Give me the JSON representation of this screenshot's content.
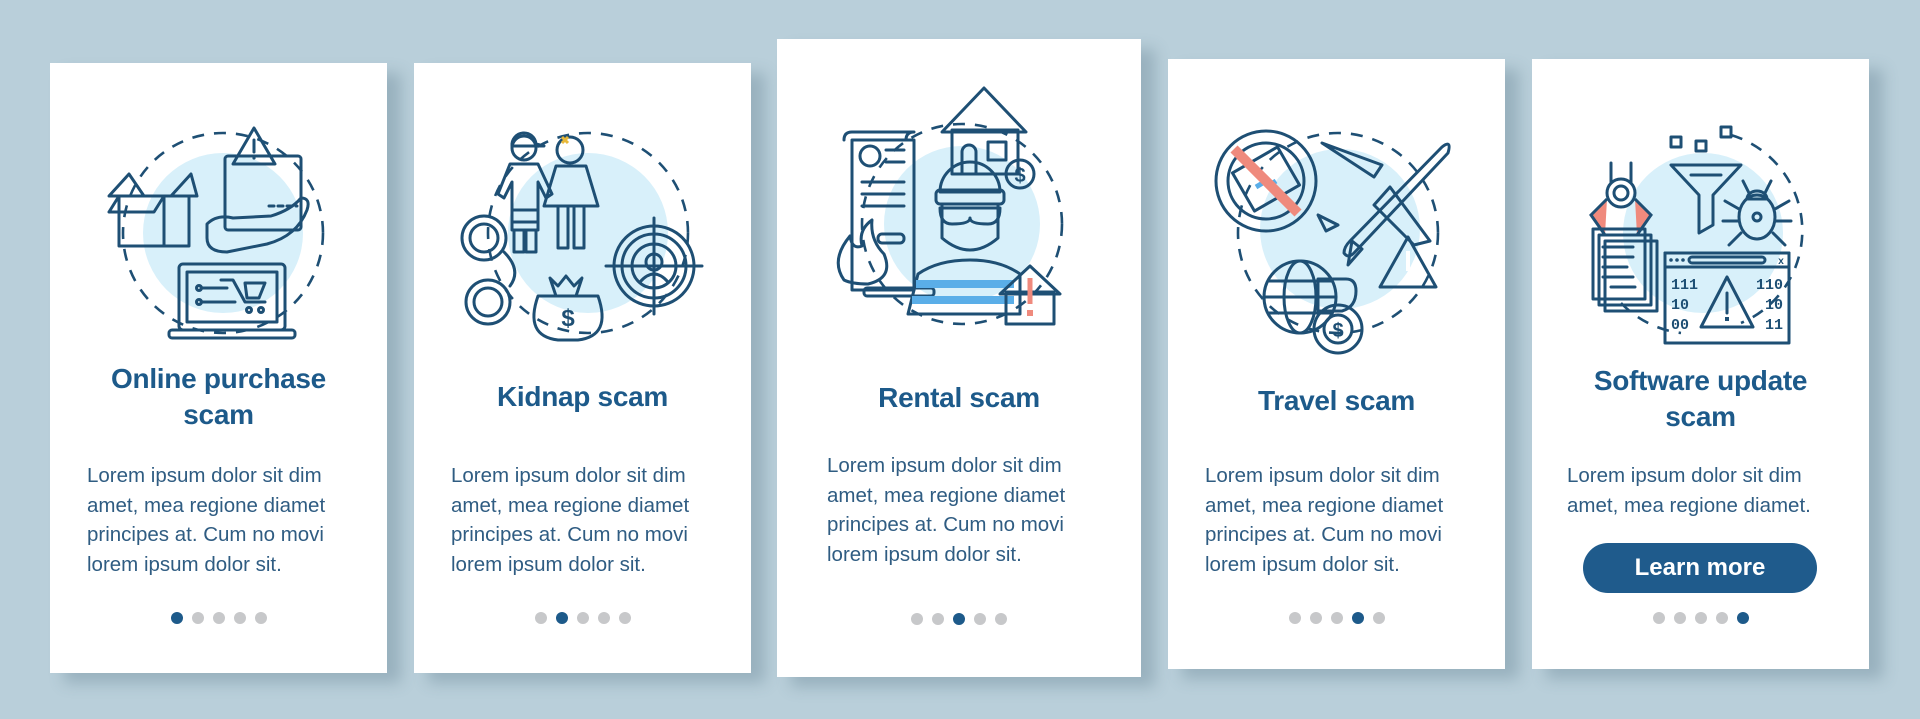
{
  "colors": {
    "background": "#b9cfda",
    "card": "#ffffff",
    "primary": "#1d5a8a",
    "body_text": "#2f5c82",
    "dot_inactive": "#c7c8ca",
    "illustration_blue": "#5aaee8",
    "illustration_yellow": "#f6d17f",
    "illustration_red": "#ef8a7d",
    "illustration_bg": "#d8f0fa"
  },
  "screens": [
    {
      "title_line1": "Online purchase",
      "title_line2": "scam",
      "illustration": "online-purchase-illustration",
      "body": "Lorem ipsum dolor sit dim\namet, mea regione diamet\nprincipes at. Cum no movi\nlorem ipsum dolor sit.",
      "page_index": 1,
      "page_count": 5
    },
    {
      "title_line1": "Kidnap scam",
      "illustration": "kidnap-illustration",
      "body": "Lorem ipsum dolor sit dim\namet, mea regione diamet\nprincipes at. Cum no movi\nlorem ipsum dolor sit.",
      "page_index": 2,
      "page_count": 5
    },
    {
      "title_line1": "Rental scam",
      "illustration": "rental-illustration",
      "body": "Lorem ipsum dolor sit dim\namet, mea regione diamet\nprincipes at. Cum no movi\nlorem ipsum dolor sit.",
      "page_index": 3,
      "page_count": 5
    },
    {
      "title_line1": "Travel scam",
      "illustration": "travel-illustration",
      "body": "Lorem ipsum dolor sit dim\namet, mea regione diamet\nprincipes at. Cum no movi\nlorem ipsum dolor sit.",
      "page_index": 4,
      "page_count": 5
    },
    {
      "title_line1": "Software update",
      "title_line2": "scam",
      "illustration": "software-update-illustration",
      "body": "Lorem ipsum dolor sit dim\namet, mea regione diamet.",
      "button_label": "Learn more",
      "page_index": 5,
      "page_count": 5
    }
  ],
  "binary_text": {
    "left": [
      "111",
      "10",
      "00"
    ],
    "right": [
      "110",
      "10",
      "11"
    ]
  },
  "currency_symbol": "$",
  "window_close_glyph": "x"
}
